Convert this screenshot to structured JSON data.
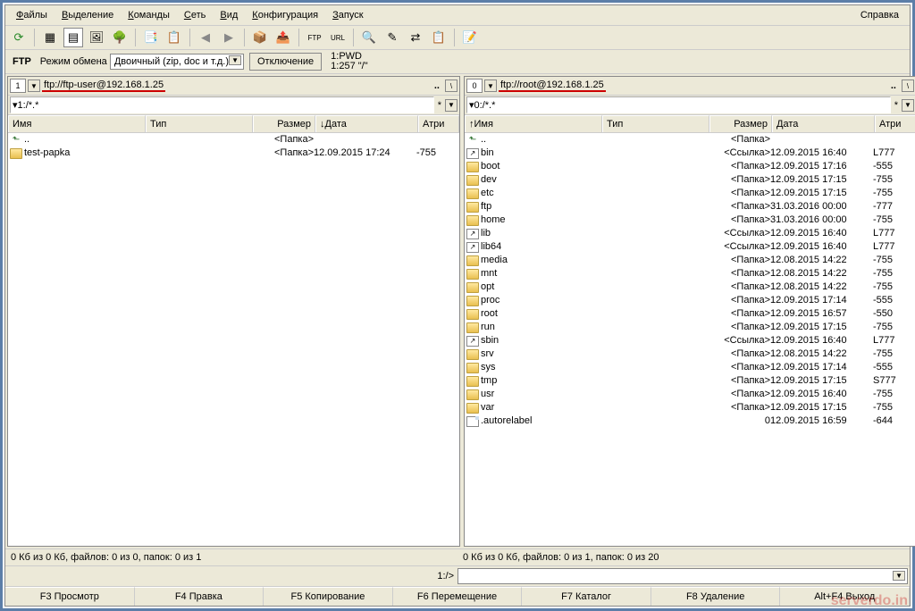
{
  "menu": {
    "items": [
      "Файлы",
      "Выделение",
      "Команды",
      "Сеть",
      "Вид",
      "Конфигурация",
      "Запуск"
    ],
    "help": "Справка"
  },
  "ftp_bar": {
    "label": "FTP",
    "mode_label": "Режим обмена",
    "mode_value": "Двоичный (zip, doc и т.д.)",
    "disconnect": "Отключение",
    "log1": "1:PWD",
    "log2": "1:257 \"/\""
  },
  "left": {
    "drive": "1",
    "addr": "ftp://ftp-user@192.168.1.25",
    "path": "▾1:/*.*",
    "headers": {
      "name": "Имя",
      "type": "Тип",
      "size": "Размер",
      "date": "Дата",
      "attr": "Атри"
    },
    "rows": [
      {
        "icon": "up",
        "name": "..",
        "type": "",
        "size": "<Папка>",
        "date": "",
        "attr": ""
      },
      {
        "icon": "folder",
        "name": "test-papka",
        "type": "",
        "size": "<Папка>",
        "date": "12.09.2015 17:24",
        "attr": "-755"
      }
    ],
    "status": "0 Кб из 0 Кб, файлов: 0 из 0, папок: 0 из 1"
  },
  "right": {
    "drive": "0",
    "addr": "ftp://root@192.168.1.25",
    "path": "▾0:/*.*",
    "headers": {
      "name": "Имя",
      "type": "Тип",
      "size": "Размер",
      "date": "Дата",
      "attr": "Атри"
    },
    "rows": [
      {
        "icon": "up",
        "name": "..",
        "type": "",
        "size": "<Папка>",
        "date": "",
        "attr": ""
      },
      {
        "icon": "link",
        "name": "bin",
        "type": "",
        "size": "<Ссылка>",
        "date": "12.09.2015 16:40",
        "attr": "L777"
      },
      {
        "icon": "folder",
        "name": "boot",
        "type": "",
        "size": "<Папка>",
        "date": "12.09.2015 17:16",
        "attr": "-555"
      },
      {
        "icon": "folder",
        "name": "dev",
        "type": "",
        "size": "<Папка>",
        "date": "12.09.2015 17:15",
        "attr": "-755"
      },
      {
        "icon": "folder",
        "name": "etc",
        "type": "",
        "size": "<Папка>",
        "date": "12.09.2015 17:15",
        "attr": "-755"
      },
      {
        "icon": "folder",
        "name": "ftp",
        "type": "",
        "size": "<Папка>",
        "date": "31.03.2016 00:00",
        "attr": "-777"
      },
      {
        "icon": "folder",
        "name": "home",
        "type": "",
        "size": "<Папка>",
        "date": "31.03.2016 00:00",
        "attr": "-755"
      },
      {
        "icon": "link",
        "name": "lib",
        "type": "",
        "size": "<Ссылка>",
        "date": "12.09.2015 16:40",
        "attr": "L777"
      },
      {
        "icon": "link",
        "name": "lib64",
        "type": "",
        "size": "<Ссылка>",
        "date": "12.09.2015 16:40",
        "attr": "L777"
      },
      {
        "icon": "folder",
        "name": "media",
        "type": "",
        "size": "<Папка>",
        "date": "12.08.2015 14:22",
        "attr": "-755"
      },
      {
        "icon": "folder",
        "name": "mnt",
        "type": "",
        "size": "<Папка>",
        "date": "12.08.2015 14:22",
        "attr": "-755"
      },
      {
        "icon": "folder",
        "name": "opt",
        "type": "",
        "size": "<Папка>",
        "date": "12.08.2015 14:22",
        "attr": "-755"
      },
      {
        "icon": "folder",
        "name": "proc",
        "type": "",
        "size": "<Папка>",
        "date": "12.09.2015 17:14",
        "attr": "-555"
      },
      {
        "icon": "folder",
        "name": "root",
        "type": "",
        "size": "<Папка>",
        "date": "12.09.2015 16:57",
        "attr": "-550"
      },
      {
        "icon": "folder",
        "name": "run",
        "type": "",
        "size": "<Папка>",
        "date": "12.09.2015 17:15",
        "attr": "-755"
      },
      {
        "icon": "link",
        "name": "sbin",
        "type": "",
        "size": "<Ссылка>",
        "date": "12.09.2015 16:40",
        "attr": "L777"
      },
      {
        "icon": "folder",
        "name": "srv",
        "type": "",
        "size": "<Папка>",
        "date": "12.08.2015 14:22",
        "attr": "-755"
      },
      {
        "icon": "folder",
        "name": "sys",
        "type": "",
        "size": "<Папка>",
        "date": "12.09.2015 17:14",
        "attr": "-555"
      },
      {
        "icon": "folder",
        "name": "tmp",
        "type": "",
        "size": "<Папка>",
        "date": "12.09.2015 17:15",
        "attr": "S777"
      },
      {
        "icon": "folder",
        "name": "usr",
        "type": "",
        "size": "<Папка>",
        "date": "12.09.2015 16:40",
        "attr": "-755"
      },
      {
        "icon": "folder",
        "name": "var",
        "type": "",
        "size": "<Папка>",
        "date": "12.09.2015 17:15",
        "attr": "-755"
      },
      {
        "icon": "file",
        "name": ".autorelabel",
        "type": "",
        "size": "0",
        "date": "12.09.2015 16:59",
        "attr": "-644"
      }
    ],
    "status": "0 Кб из 0 Кб, файлов: 0 из 1, папок: 0 из 20"
  },
  "cmd_prompt": "1:/>",
  "fn": [
    "F3 Просмотр",
    "F4 Правка",
    "F5 Копирование",
    "F6 Перемещение",
    "F7 Каталог",
    "F8 Удаление",
    "Alt+F4 Выход"
  ],
  "watermark": "serverdo.in"
}
